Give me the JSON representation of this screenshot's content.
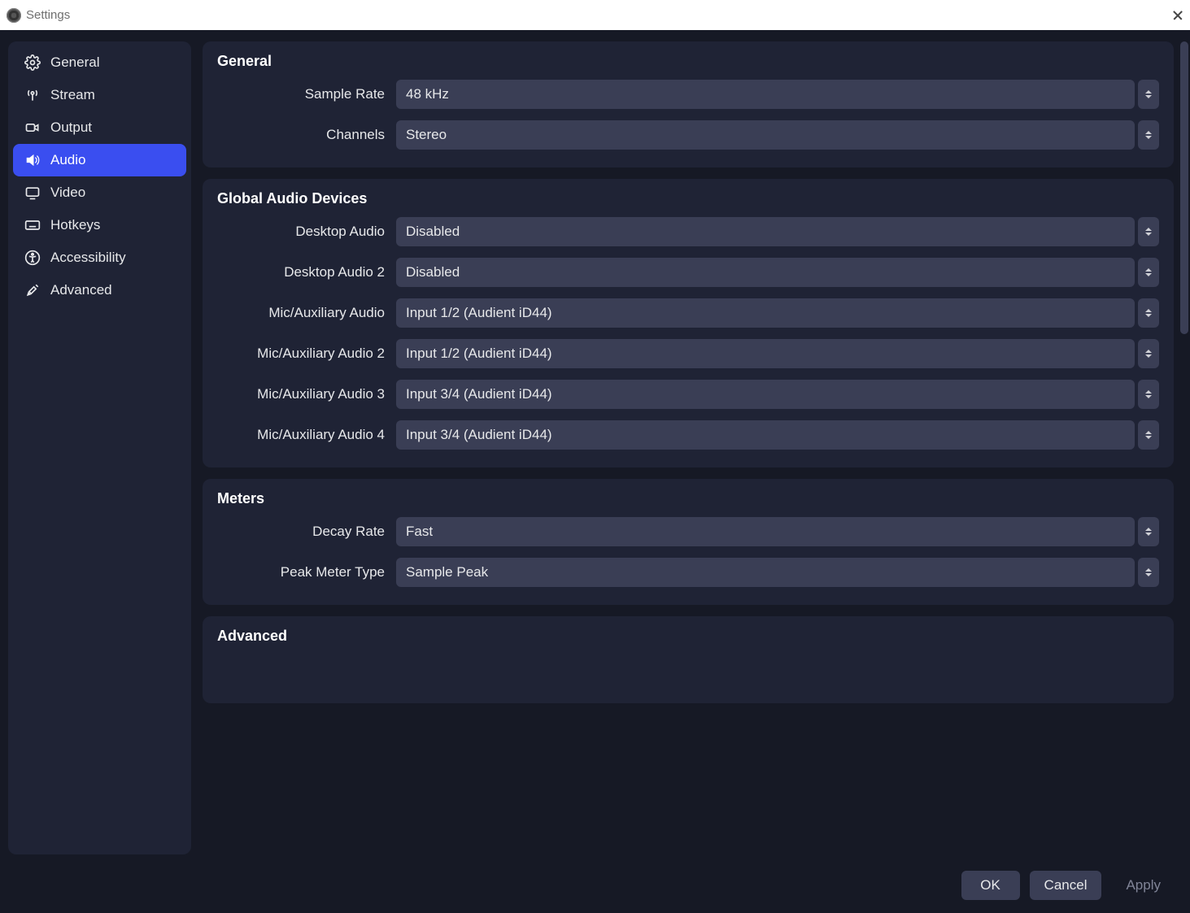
{
  "window": {
    "title": "Settings"
  },
  "sidebar": {
    "active_index": 3,
    "items": [
      {
        "label": "General"
      },
      {
        "label": "Stream"
      },
      {
        "label": "Output"
      },
      {
        "label": "Audio"
      },
      {
        "label": "Video"
      },
      {
        "label": "Hotkeys"
      },
      {
        "label": "Accessibility"
      },
      {
        "label": "Advanced"
      }
    ]
  },
  "sections": {
    "general": {
      "title": "General",
      "sample_rate": {
        "label": "Sample Rate",
        "value": "48 kHz"
      },
      "channels": {
        "label": "Channels",
        "value": "Stereo"
      }
    },
    "global_audio": {
      "title": "Global Audio Devices",
      "desktop_audio": {
        "label": "Desktop Audio",
        "value": "Disabled"
      },
      "desktop_audio_2": {
        "label": "Desktop Audio 2",
        "value": "Disabled"
      },
      "mic_aux": {
        "label": "Mic/Auxiliary Audio",
        "value": "Input 1/2 (Audient iD44)"
      },
      "mic_aux_2": {
        "label": "Mic/Auxiliary Audio 2",
        "value": "Input 1/2 (Audient iD44)"
      },
      "mic_aux_3": {
        "label": "Mic/Auxiliary Audio 3",
        "value": "Input 3/4 (Audient iD44)"
      },
      "mic_aux_4": {
        "label": "Mic/Auxiliary Audio 4",
        "value": "Input 3/4 (Audient iD44)"
      }
    },
    "meters": {
      "title": "Meters",
      "decay_rate": {
        "label": "Decay Rate",
        "value": "Fast"
      },
      "peak_meter_type": {
        "label": "Peak Meter Type",
        "value": "Sample Peak"
      }
    },
    "advanced": {
      "title": "Advanced"
    }
  },
  "footer": {
    "ok": "OK",
    "cancel": "Cancel",
    "apply": "Apply"
  }
}
